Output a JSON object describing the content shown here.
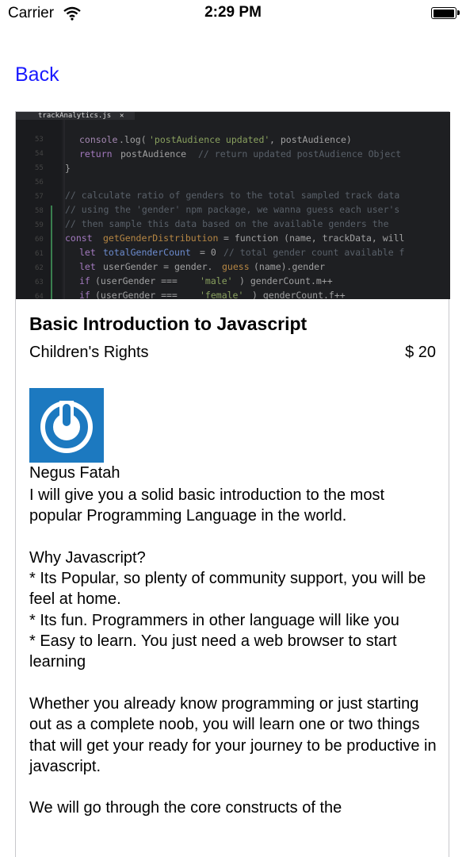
{
  "status_bar": {
    "carrier": "Carrier",
    "time": "2:29 PM",
    "wifi_icon": "wifi-icon",
    "battery_icon": "battery-full-icon"
  },
  "nav": {
    "back_label": "Back"
  },
  "course": {
    "image_tab": "trackAnalytics.js",
    "title": "Basic Introduction to Javascript",
    "category": "Children's Rights",
    "price": "$ 20",
    "author": {
      "name": "Negus Fatah",
      "avatar_icon": "power-logo-icon"
    },
    "description": "I will give you a solid basic introduction to the most popular Programming Language in the world.\n\nWhy Javascript?\n* Its Popular, so plenty of community support, you will be feel at home.\n* Its fun. Programmers in other language will like you\n* Easy to learn. You just need a web browser to start learning\n\nWhether you already know programming or just starting out as a complete noob, you will learn one or two things that will get your ready for your journey to be productive in javascript.\n\nWe will go through the core constructs of the"
  },
  "colors": {
    "link": "#1a1aff",
    "avatar_bg": "#1c79c0",
    "code_bg": "#1e1f22"
  }
}
